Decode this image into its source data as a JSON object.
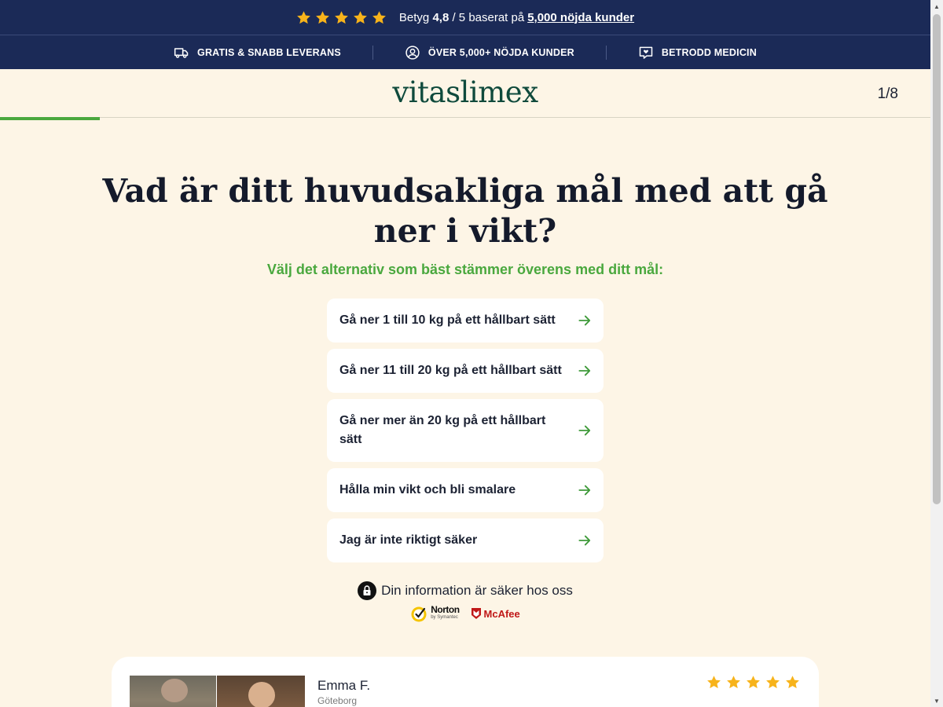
{
  "rating_bar": {
    "stars": 5,
    "star_color": "#f7b31b",
    "prefix": "Betyg",
    "score": "4,8",
    "suffix": "/ 5 baserat på",
    "link": "5,000 nöjda kunder"
  },
  "features": [
    {
      "icon": "truck-icon",
      "label": "GRATIS & SNABB LEVERANS"
    },
    {
      "icon": "user-circle-icon",
      "label": "ÖVER 5,000+ NÖJDA KUNDER"
    },
    {
      "icon": "heart-message-icon",
      "label": "BETRODD MEDICIN"
    }
  ],
  "header": {
    "logo": "vitaslimex",
    "step": "1/8",
    "progress": 0.107
  },
  "main": {
    "question": "Vad är ditt huvudsakliga mål med att gå ner i vikt?",
    "subtitle": "Välj det alternativ som bäst stämmer överens med ditt mål:",
    "options": [
      "Gå ner 1 till 10 kg på ett hållbart sätt",
      "Gå ner 11 till 20 kg på ett hållbart sätt",
      "Gå ner mer än 20 kg på ett hållbart sätt",
      "Hålla min vikt och bli smalare",
      "Jag är inte riktigt säker"
    ],
    "secure_text": "Din information är säker hos oss",
    "badges": {
      "norton": "Norton",
      "norton_sub": "by Symantec",
      "mcafee": "McAfee"
    }
  },
  "review": {
    "name": "Emma F.",
    "city": "Göteborg",
    "stars": 5
  },
  "colors": {
    "navy": "#1b2a57",
    "green": "#4aa83e",
    "cream": "#fdf5e6",
    "logo_green": "#0f4a3c"
  }
}
